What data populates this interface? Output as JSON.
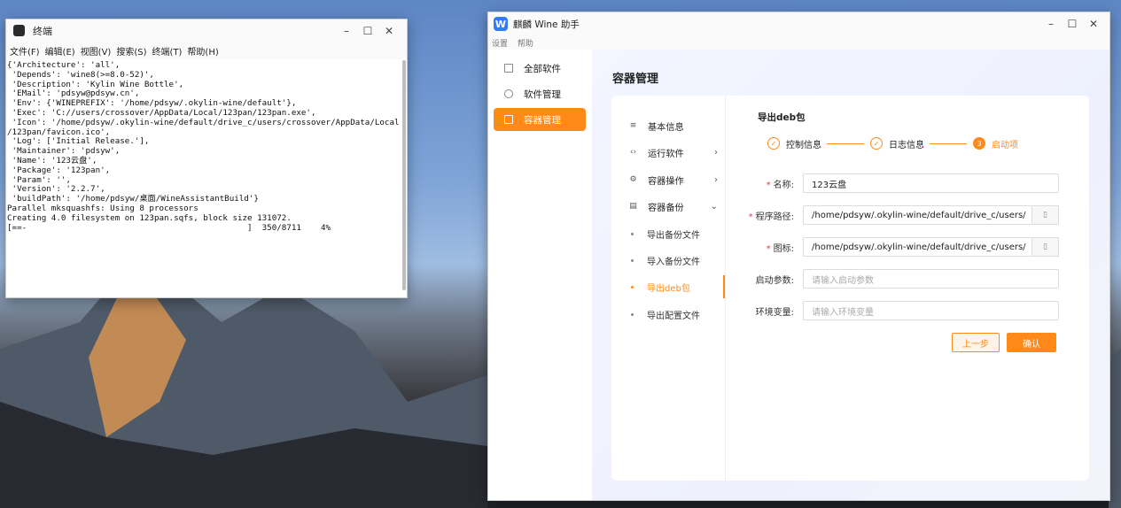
{
  "terminal": {
    "title": "终端",
    "menu": [
      "文件(F)",
      "编辑(E)",
      "视图(V)",
      "搜索(S)",
      "终端(T)",
      "帮助(H)"
    ],
    "lines": [
      "{'Architecture': 'all',",
      " 'Depends': 'wine8(>=8.0-52)',",
      " 'Description': 'Kylin Wine Bottle',",
      " 'EMail': 'pdsyw@pdsyw.cn',",
      " 'Env': {'WINEPREFIX': '/home/pdsyw/.okylin-wine/default'},",
      " 'Exec': 'C://users/crossover/AppData/Local/123pan/123pan.exe',",
      " 'Icon': '/home/pdsyw/.okylin-wine/default/drive_c/users/crossover/AppData/Local",
      "/123pan/favicon.ico',",
      " 'Log': ['Initial Release.'],",
      " 'Maintainer': 'pdsyw',",
      " 'Name': '123云盘',",
      " 'Package': '123pan',",
      " 'Param': '',",
      " 'Version': '2.2.7',",
      " 'buildPath': '/home/pdsyw/桌面/WineAssistantBuild'}",
      "Parallel mksquashfs: Using 8 processors",
      "Creating 4.0 filesystem on 123pan.sqfs, block size 131072.",
      "[==-                                             ]  350/8711    4%"
    ],
    "progress_fraction": 0.04
  },
  "wine": {
    "title": "麒麟 Wine 助手",
    "logo_letter": "W",
    "menu": [
      "设置",
      "帮助"
    ],
    "sidebar": [
      {
        "label": "全部软件"
      },
      {
        "label": "软件管理"
      },
      {
        "label": "容器管理",
        "active": true
      }
    ],
    "page_title": "容器管理",
    "submenu": {
      "basic_info": "基本信息",
      "run_software": "运行软件",
      "container_ops": "容器操作",
      "container_backup": "容器备份",
      "children": [
        "导出备份文件",
        "导入备份文件",
        "导出deb包",
        "导出配置文件"
      ],
      "active_child": "导出deb包"
    },
    "section_title": "导出deb包",
    "steps": [
      {
        "label": "控制信息",
        "state": "done"
      },
      {
        "label": "日志信息",
        "state": "done"
      },
      {
        "label": "启动项",
        "state": "current",
        "number": "3"
      }
    ],
    "form": {
      "name_label": "名称:",
      "name_value": "123云盘",
      "path_label": "程序路径:",
      "path_value": "/home/pdsyw/.okylin-wine/default/drive_c/users/",
      "icon_label": "图标:",
      "icon_value": "/home/pdsyw/.okylin-wine/default/drive_c/users/",
      "args_label": "启动参数:",
      "args_placeholder": "请输入启动参数",
      "env_label": "环境变量:",
      "env_placeholder": "请输入环境变量",
      "prev_button": "上一步",
      "confirm_button": "确认"
    }
  }
}
